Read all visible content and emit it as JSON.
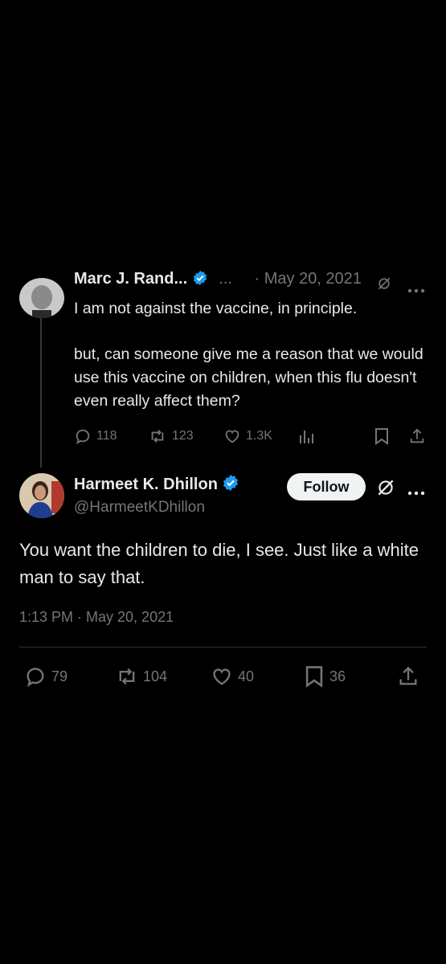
{
  "reply": {
    "author_name": "Marc J. Rand...",
    "ellipsis": "...",
    "date": "· May 20, 2021",
    "text_lines": [
      "I am not against the vaccine, in principle.",
      "but, can someone give me a reason that we would use this vaccine on children, when this flu doesn't even really affect them?"
    ],
    "stats": {
      "replies": "118",
      "reposts": "123",
      "likes": "1.3K"
    }
  },
  "main": {
    "author_name": "Harmeet K. Dhillon",
    "handle": "@HarmeetKDhillon",
    "follow_label": "Follow",
    "text": "You want the children to die, I see. Just like a white man to say that.",
    "timestamp": "1:13 PM · May 20, 2021",
    "stats": {
      "replies": "79",
      "reposts": "104",
      "likes": "40",
      "bookmarks": "36"
    }
  },
  "colors": {
    "background": "#000000",
    "text": "#e7e9ea",
    "muted": "#71767b",
    "verified": "#1d9bf0",
    "divider": "#2f3336",
    "button_bg": "#eff3f4"
  },
  "icons": [
    "reply-icon",
    "repost-icon",
    "like-icon",
    "views-icon",
    "bookmark-icon",
    "share-icon",
    "verified-badge-icon",
    "grok-icon",
    "more-icon"
  ]
}
